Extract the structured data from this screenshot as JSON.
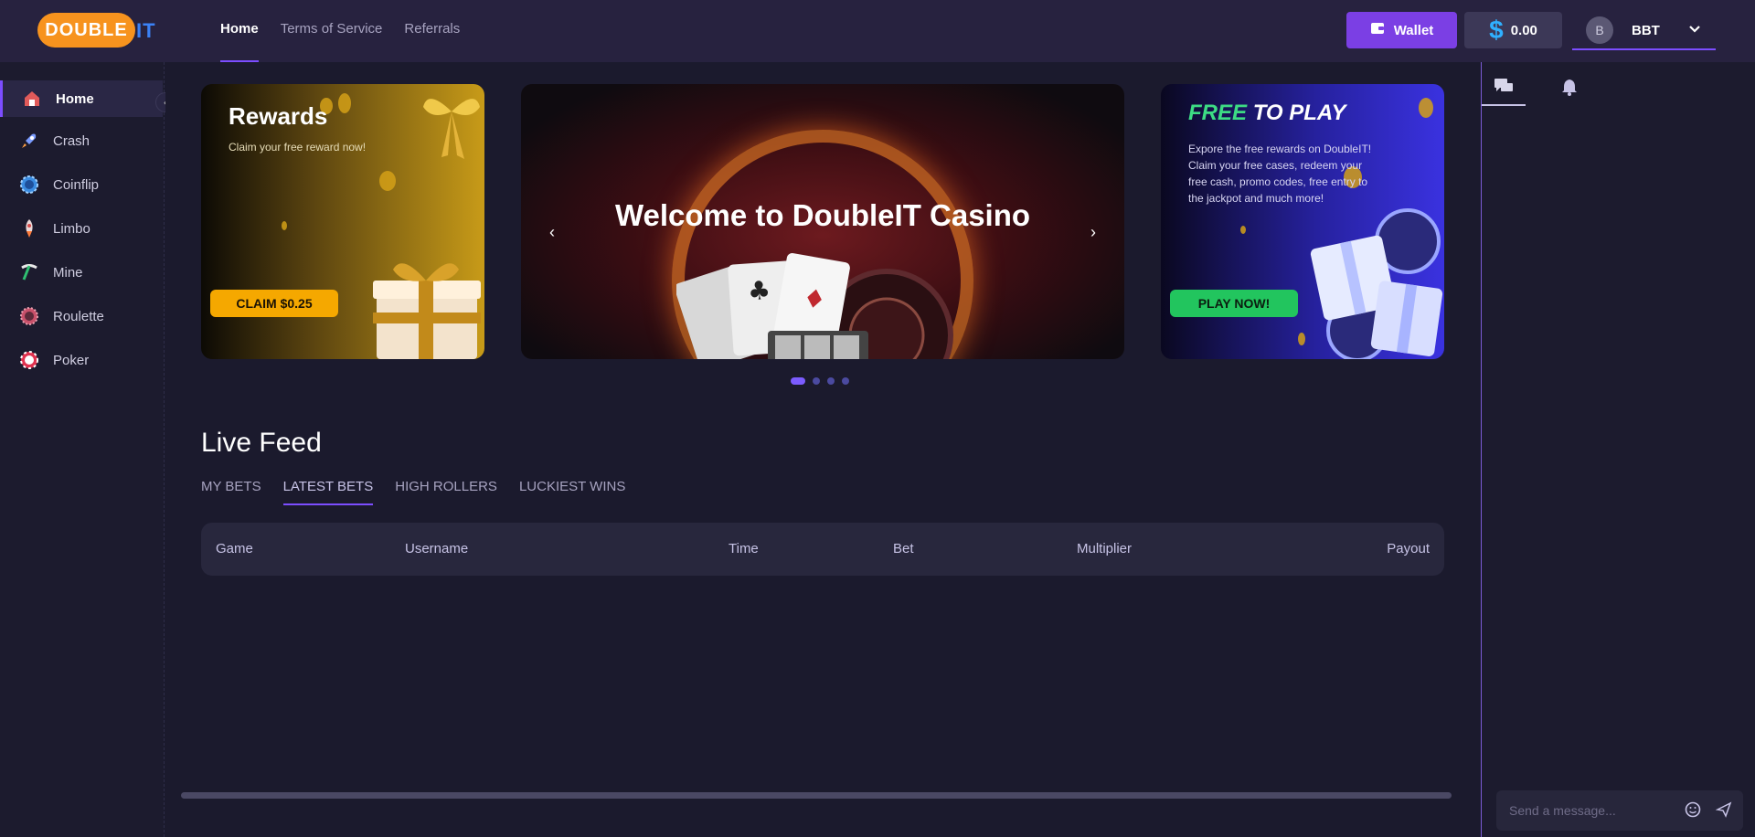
{
  "header": {
    "logo_main": "DOUBLE",
    "logo_suffix": "IT",
    "nav": [
      {
        "label": "Home",
        "active": true
      },
      {
        "label": "Terms of Service",
        "active": false
      },
      {
        "label": "Referrals",
        "active": false
      }
    ],
    "wallet_label": "Wallet",
    "balance": "0.00",
    "user_initial": "B",
    "user_name": "BBT"
  },
  "sidebar": {
    "items": [
      {
        "label": "Home",
        "icon": "home-icon",
        "active": true
      },
      {
        "label": "Crash",
        "icon": "rocket-icon",
        "active": false
      },
      {
        "label": "Coinflip",
        "icon": "coin-icon",
        "active": false
      },
      {
        "label": "Limbo",
        "icon": "limbo-rocket-icon",
        "active": false
      },
      {
        "label": "Mine",
        "icon": "pickaxe-icon",
        "active": false
      },
      {
        "label": "Roulette",
        "icon": "roulette-wheel-icon",
        "active": false
      },
      {
        "label": "Poker",
        "icon": "poker-chip-icon",
        "active": false
      }
    ]
  },
  "banners": {
    "rewards": {
      "title": "Rewards",
      "subtitle": "Claim your free reward now!",
      "button": "CLAIM $0.25"
    },
    "welcome": {
      "title": "Welcome to DoubleIT Casino"
    },
    "free": {
      "title_accent": "FREE",
      "title_rest": "TO PLAY",
      "text": "Expore the free rewards on DoubleIT! Claim your free cases, redeem your free cash, promo codes, free entry to the jackpot and much more!",
      "button": "PLAY NOW!"
    },
    "slides_total": 4,
    "slide_active": 1
  },
  "live_feed": {
    "title": "Live Feed",
    "tabs": [
      {
        "label": "MY BETS",
        "active": false
      },
      {
        "label": "LATEST BETS",
        "active": true
      },
      {
        "label": "HIGH ROLLERS",
        "active": false
      },
      {
        "label": "LUCKIEST WINS",
        "active": false
      }
    ],
    "columns": [
      "Game",
      "Username",
      "Time",
      "Bet",
      "Multiplier",
      "Payout"
    ]
  },
  "chat": {
    "placeholder": "Send a message...",
    "tabs": [
      "chat-icon",
      "bell-icon"
    ]
  },
  "colors": {
    "accent": "#7c4dff",
    "logo": "#f7931e",
    "claim": "#f5a800",
    "play": "#22c55e"
  }
}
